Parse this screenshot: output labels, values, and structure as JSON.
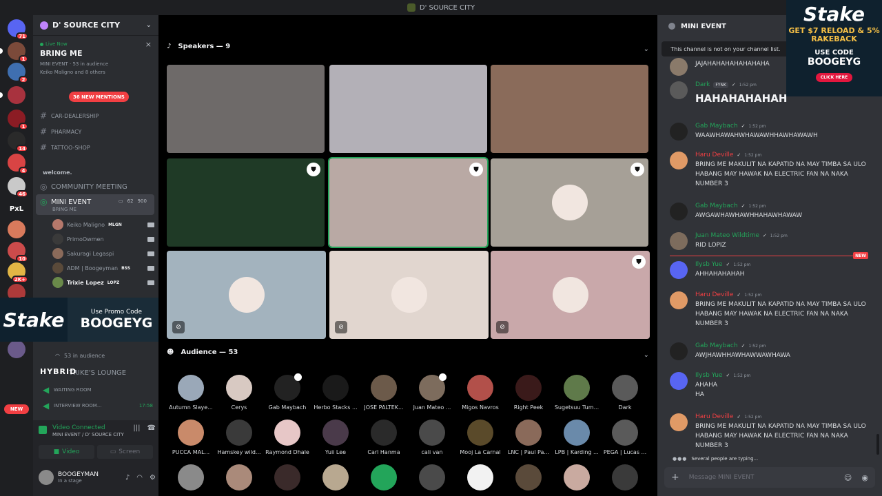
{
  "window": {
    "title": "D' SOURCE CITY"
  },
  "rail": {
    "servers": [
      {
        "name": "discord-home",
        "badge": "71",
        "color": "#5865f2"
      },
      {
        "name": "server-1",
        "badge": "1",
        "color": "#7b4a3a"
      },
      {
        "name": "server-2",
        "badge": "2",
        "color": "#3f6fb0"
      },
      {
        "name": "server-3",
        "badge": "",
        "color": "#a8323e"
      },
      {
        "name": "server-4",
        "badge": "1",
        "color": "#8c1c24"
      },
      {
        "name": "server-5",
        "badge": "14",
        "color": "#2a2a2a"
      },
      {
        "name": "server-6",
        "badge": "4",
        "color": "#d94444"
      },
      {
        "name": "server-7",
        "badge": "46",
        "color": "#c9c9c9"
      },
      {
        "name": "server-pxl",
        "badge": "",
        "color": "#1e1f22"
      },
      {
        "name": "server-9",
        "badge": "",
        "color": "#d97a5c"
      },
      {
        "name": "server-10",
        "badge": "10",
        "color": "#cc4b4b"
      },
      {
        "name": "server-11",
        "badge": "2K+",
        "color": "#e2b545"
      },
      {
        "name": "server-12",
        "badge": "1",
        "color": "#ad3a3a"
      },
      {
        "name": "server-13",
        "badge": "11",
        "color": "#c2a35a"
      },
      {
        "name": "server-14",
        "badge": "",
        "color": "#6a5a8a"
      }
    ],
    "pxl_label": "PxL",
    "new_label": "NEW"
  },
  "sidebar": {
    "guild_name": "D' SOURCE CITY",
    "live": {
      "status": "Live Now",
      "title": "BRING ME",
      "meta": "MINI EVENT · 53 in audience",
      "sub": "Keiko Maligno and 8 others"
    },
    "mention_pill": "36 NEW MENTIONS",
    "channels": [
      {
        "label": "CAR-DEALERSHIP"
      },
      {
        "label": "PHARMACY"
      },
      {
        "label": "TATTOO-SHOP"
      }
    ],
    "welcome": "welcome.",
    "community": "COMMUNITY MEETING",
    "mini_event": {
      "name": "MINI EVENT",
      "sub": "BRING ME",
      "count_a": "62",
      "count_b": "900"
    },
    "voice_users": [
      {
        "name": "Keiko Maligno",
        "tag": "MLGN"
      },
      {
        "name": "PrimoOwmen",
        "tag": ""
      },
      {
        "name": "Sakuragi Legaspi",
        "tag": ""
      },
      {
        "name": "ADM | Boogeyman",
        "tag": "BSS"
      },
      {
        "name": "Trixie Lopez",
        "tag": "LOPZ"
      }
    ],
    "audience_line": "53 in audience",
    "lounge": "TRIKE'S LOUNGE",
    "waiting_room": "WAITING ROOM",
    "interview_room": "INTERVIEW ROOM...",
    "interview_time": "17:58"
  },
  "stake_left": {
    "logo": "Stake",
    "small": "Use Promo Code",
    "code": "BOOGEYG"
  },
  "hybrid": "HYBRID",
  "voice_panel": {
    "status": "Video Connected",
    "location": "MINI EVENT / D' SOURCE CITY",
    "video_label": "Video",
    "screen_label": "Screen",
    "user_name": "BOOGEYMAN",
    "user_status": "In a stage"
  },
  "stage": {
    "speakers_label": "Speakers — 9",
    "audience_label": "Audience — 53",
    "speakers": [
      {
        "name": "speaker-1",
        "bg": "#6e6a69",
        "shield": false,
        "mute": false,
        "avatar": false
      },
      {
        "name": "speaker-2",
        "bg": "#b3b0b7",
        "shield": false,
        "mute": false,
        "avatar": false
      },
      {
        "name": "speaker-3",
        "bg": "#8a6b5a",
        "shield": false,
        "mute": false,
        "avatar": false
      },
      {
        "name": "speaker-4",
        "bg": "#1f3a26",
        "shield": true,
        "mute": false,
        "avatar": false
      },
      {
        "name": "speaker-5",
        "bg": "#b9a9a4",
        "shield": true,
        "mute": false,
        "avatar": false
      },
      {
        "name": "speaker-6",
        "bg": "#a6a097",
        "shield": true,
        "mute": false,
        "avatar": true
      },
      {
        "name": "speaker-7",
        "bg": "#a3b3be",
        "shield": false,
        "mute": true,
        "avatar": true
      },
      {
        "name": "speaker-8",
        "bg": "#e1d6cf",
        "shield": false,
        "mute": true,
        "avatar": true
      },
      {
        "name": "speaker-9",
        "bg": "#c9a8aa",
        "shield": true,
        "mute": true,
        "avatar": true
      }
    ],
    "audience": [
      {
        "name": "Autumn Slaye...",
        "color": "#9aa8b8"
      },
      {
        "name": "Cerys",
        "color": "#d8c9c2"
      },
      {
        "name": "Gab Maybach",
        "color": "#222222"
      },
      {
        "name": "Herbo Stacks ...",
        "color": "#1a1a1a"
      },
      {
        "name": "JOSE PALTEK...",
        "color": "#6c5a4a"
      },
      {
        "name": "Juan Mateo ...",
        "color": "#7d6c5d"
      },
      {
        "name": "Migos Navros",
        "color": "#b2504a"
      },
      {
        "name": "Right Peek",
        "color": "#3a1a1a"
      },
      {
        "name": "Sugetsuu Tum...",
        "color": "#5f7a4a"
      },
      {
        "name": "Dark",
        "color": "#5a5a5a"
      },
      {
        "name": "PUCCA MAL...",
        "color": "#c98a6a"
      },
      {
        "name": "Hamskey wild...",
        "color": "#3a3a3a"
      },
      {
        "name": "Raymond Dhale",
        "color": "#e7c7c7"
      },
      {
        "name": "Yuii Lee",
        "color": "#4a3a4a"
      },
      {
        "name": "Carl Hanma",
        "color": "#2a2a2a"
      },
      {
        "name": "cali van",
        "color": "#4a4a4a"
      },
      {
        "name": "Mooj La Carnal",
        "color": "#5a4a2a"
      },
      {
        "name": "LNC | Paul Pa...",
        "color": "#8a6a5a"
      },
      {
        "name": "LPB | Karding ...",
        "color": "#6a8aaa"
      },
      {
        "name": "PEGA | Lucas ...",
        "color": "#5a5a5a"
      },
      {
        "name": "",
        "color": "#8a8a8a"
      },
      {
        "name": "",
        "color": "#aa8a7a"
      },
      {
        "name": "",
        "color": "#3a2a2a"
      },
      {
        "name": "",
        "color": "#b8a890"
      },
      {
        "name": "",
        "color": "#23a55a"
      },
      {
        "name": "",
        "color": "#4a4a4a"
      },
      {
        "name": "",
        "color": "#f2f2f2"
      },
      {
        "name": "",
        "color": "#5a4a3a"
      },
      {
        "name": "",
        "color": "#c9aaa0"
      },
      {
        "name": "",
        "color": "#3a3a3a"
      }
    ]
  },
  "chat": {
    "title": "MINI EVENT",
    "not_in_list": "This channel is not on your channel list.",
    "messages": [
      {
        "author": "",
        "color": "#dbdee1",
        "time": "",
        "text": "JAJAHAHAHAHAHAHAHA",
        "big": false,
        "av": "#8a7a6a"
      },
      {
        "author": "Dark",
        "color": "#23a55a",
        "tag": "FYNK",
        "time": "1:52 pm",
        "text": "HAHAHAHAHAH",
        "big": true,
        "av": "#5a5a5a"
      },
      {
        "author": "Gab Maybach",
        "color": "#23a55a",
        "time": "1:52 pm",
        "text": "WAAWHAWAHWHAWAWHHAWHAWAWH",
        "big": false,
        "av": "#222222"
      },
      {
        "author": "Haru Deville",
        "color": "#f23f43",
        "time": "1:52 pm",
        "text": "BRING ME MAKULIT NA KAPATID NA MAY TIMBA SA ULO HABANG MAY HAWAK NA ELECTRIC FAN NA NAKA NUMBER 3",
        "big": false,
        "av": "#e09a66"
      },
      {
        "author": "Gab Maybach",
        "color": "#23a55a",
        "time": "1:52 pm",
        "text": "AWGAWHAWHAWHHAHAWHAWAW",
        "big": false,
        "av": "#222222"
      },
      {
        "author": "Juan Mateo Wildtime",
        "color": "#23a55a",
        "time": "1:52 pm",
        "text": "RID LOPIZ",
        "big": false,
        "av": "#7d6c5d"
      },
      {
        "author": "Ilysb Yue",
        "color": "#23a55a",
        "time": "1:52 pm",
        "text": "AHHAHAHAHAH",
        "big": false,
        "av": "#5865f2"
      },
      {
        "author": "Haru Deville",
        "color": "#f23f43",
        "time": "1:52 pm",
        "text": "BRING ME MAKULIT NA KAPATID NA MAY TIMBA SA ULO HABANG MAY HAWAK NA ELECTRIC FAN NA NAKA NUMBER 3",
        "big": false,
        "av": "#e09a66"
      },
      {
        "author": "Gab Maybach",
        "color": "#23a55a",
        "time": "1:52 pm",
        "text": "AWJHAWHHAWHAWWAWHAWA",
        "big": false,
        "av": "#222222"
      },
      {
        "author": "Ilysb Yue",
        "color": "#23a55a",
        "time": "1:52 pm",
        "text": "AHAHA\nHA",
        "big": false,
        "av": "#5865f2"
      },
      {
        "author": "Haru Deville",
        "color": "#f23f43",
        "time": "1:52 pm",
        "text": "BRING ME MAKULIT NA KAPATID NA MAY TIMBA SA ULO HABANG MAY HAWAK NA ELECTRIC FAN NA NAKA NUMBER 3",
        "big": false,
        "av": "#e09a66"
      }
    ],
    "new_tag": "NEW",
    "typing": "Several people are typing...",
    "placeholder": "Message MINI EVENT"
  },
  "stake_ad": {
    "logo": "Stake",
    "promo": "GET $7 RELOAD & 5% RAKEBACK",
    "use": "USE CODE",
    "code": "BOOGEYG",
    "cta": "CLICK HERE"
  }
}
